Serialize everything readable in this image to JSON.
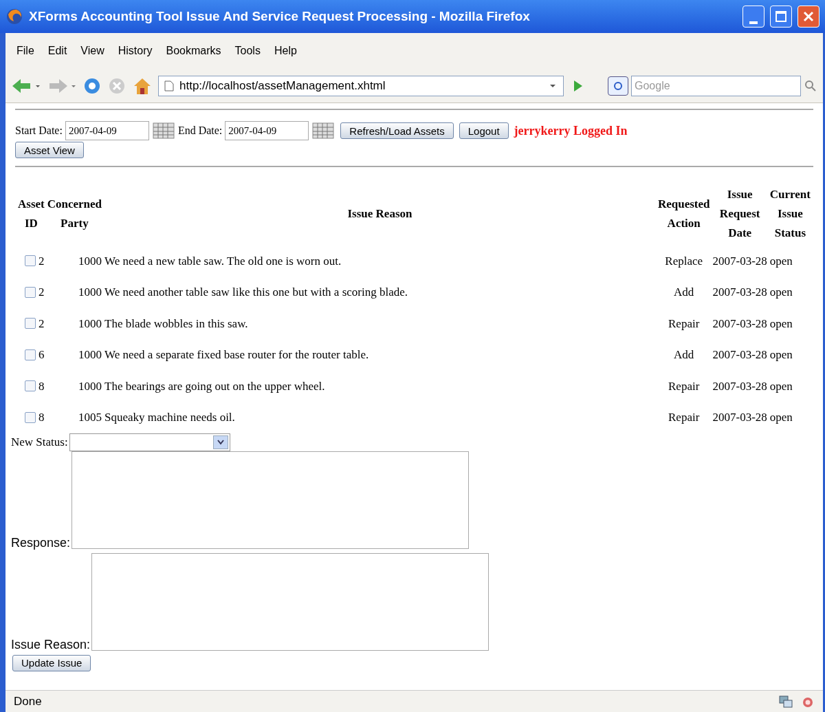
{
  "window": {
    "title": "XForms Accounting Tool Issue And Service Request Processing - Mozilla Firefox"
  },
  "menu": [
    "File",
    "Edit",
    "View",
    "History",
    "Bookmarks",
    "Tools",
    "Help"
  ],
  "address": {
    "value": "http://localhost/assetManagement.xhtml"
  },
  "search": {
    "placeholder": "Google"
  },
  "filters": {
    "start_label": "Start Date:",
    "start_value": "2007-04-09",
    "end_label": "End Date:",
    "end_value": "2007-04-09",
    "refresh_button": "Refresh/Load Assets",
    "logout_button": "Logout",
    "user_status": "jerrykerry Logged In",
    "asset_view_button": "Asset View"
  },
  "table": {
    "columns": [
      "Asset\nID",
      "Concerned\nParty",
      "Issue Reason",
      "Requested\nAction",
      "Issue\nRequest\nDate",
      "Current\nIssue\nStatus"
    ],
    "rows": [
      {
        "checked": false,
        "asset_id": "2",
        "party": "1000",
        "reason": "We need a new table saw. The old one is worn out.",
        "action": "Replace",
        "date": "2007-03-28",
        "status": "open"
      },
      {
        "checked": false,
        "asset_id": "2",
        "party": "1000",
        "reason": "We need another table saw like this one but with a scoring blade.",
        "action": "Add",
        "date": "2007-03-28",
        "status": "open"
      },
      {
        "checked": false,
        "asset_id": "2",
        "party": "1000",
        "reason": "The blade wobbles in this saw.",
        "action": "Repair",
        "date": "2007-03-28",
        "status": "open"
      },
      {
        "checked": false,
        "asset_id": "6",
        "party": "1000",
        "reason": "We need a separate fixed base router for the router table.",
        "action": "Add",
        "date": "2007-03-28",
        "status": "open"
      },
      {
        "checked": false,
        "asset_id": "8",
        "party": "1000",
        "reason": "The bearings are going out on the upper wheel.",
        "action": "Repair",
        "date": "2007-03-28",
        "status": "open"
      },
      {
        "checked": false,
        "asset_id": "8",
        "party": "1005",
        "reason": "Squeaky machine needs oil.",
        "action": "Repair",
        "date": "2007-03-28",
        "status": "open"
      }
    ]
  },
  "form": {
    "new_status_label": "New Status:",
    "response_label": "Response:",
    "issue_reason_label": "Issue Reason:",
    "update_button": "Update Issue"
  },
  "status_bar": {
    "text": "Done"
  }
}
